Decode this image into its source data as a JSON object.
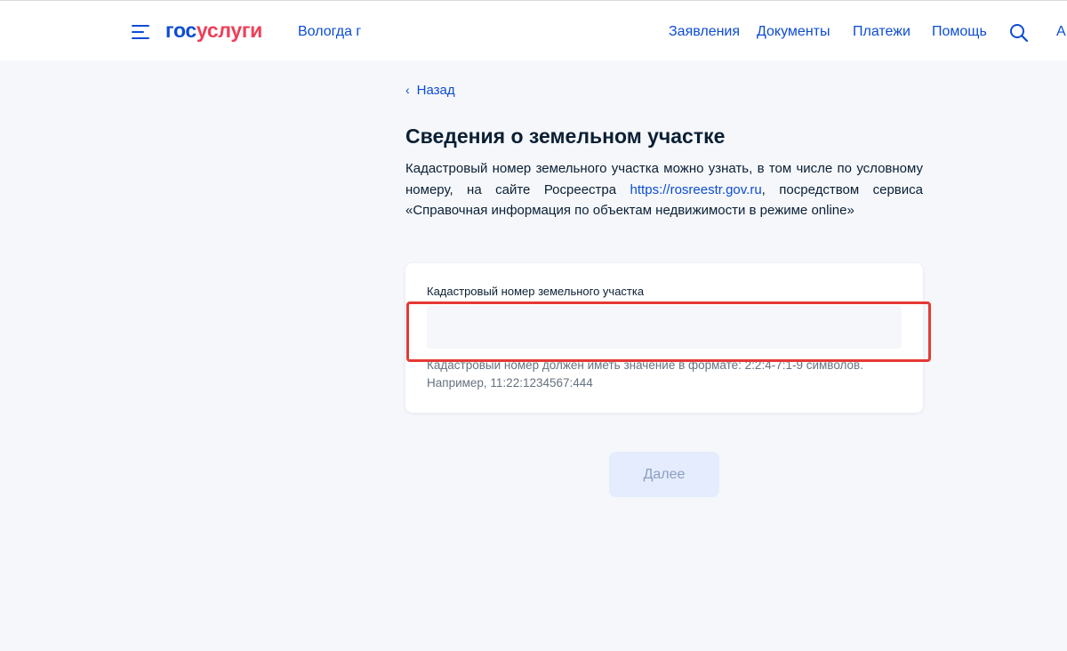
{
  "header": {
    "logo_part1": "гос",
    "logo_part2": "услуги",
    "region": "Вологда г",
    "nav": [
      "Заявления",
      "Документы",
      "Платежи",
      "Помощь"
    ],
    "user_letter": "А"
  },
  "back_link": "Назад",
  "page": {
    "title": "Сведения о земельном участке",
    "desc_before": "Кадастровый номер земельного участка можно узнать, в том числе по условному номеру, на сайте Росреестра ",
    "desc_link": "https://rosreestr.gov.ru",
    "desc_after": ", посредством сервиса «Справочная информация по объектам недвижимости в режиме online»"
  },
  "form": {
    "label": "Кадастровый номер земельного участка",
    "value": "",
    "hint_line1": "Кадастровый номер должен иметь значение в формате: 2:2:4-7:1-9 символов.",
    "hint_line2": "Например, 11:22:1234567:444"
  },
  "next_button": "Далее",
  "colors": {
    "brand_blue": "#0d4cd3",
    "brand_red": "#ee3f58",
    "highlight_red": "#e53935",
    "background": "#f5f7fb"
  },
  "icons": [
    "menu-icon",
    "search-icon",
    "chevron-left-icon"
  ]
}
